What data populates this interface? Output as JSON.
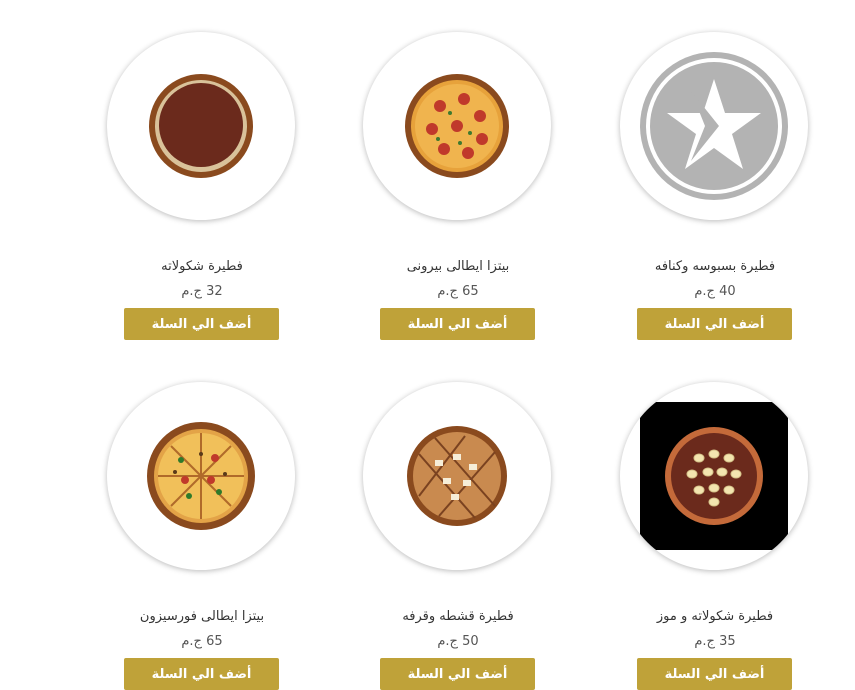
{
  "currency_label": "ج.م",
  "products": [
    {
      "name": "فطيرة بسبوسه وكنافه",
      "price": "40 ج.م",
      "button": "أضف الي السلة",
      "image": "placeholder-logo-icon"
    },
    {
      "name": "بيتزا ايطالى بيرونى",
      "price": "65 ج.م",
      "button": "أضف الي السلة",
      "image": "pepperoni-pizza-image"
    },
    {
      "name": "فطيرة شكولاته",
      "price": "32 ج.م",
      "button": "أضف الي السلة",
      "image": "chocolate-pie-image"
    },
    {
      "name": "فطيرة شكولاته و موز",
      "price": "35 ج.م",
      "button": "أضف الي السلة",
      "image": "chocolate-banana-pie-image"
    },
    {
      "name": "فطيرة قشطه وقرفه",
      "price": "50 ج.م",
      "button": "أضف الي السلة",
      "image": "cream-cinnamon-pie-image"
    },
    {
      "name": "بيتزا ايطالى فورسيزون",
      "price": "65 ج.م",
      "button": "أضف الي السلة",
      "image": "four-seasons-pizza-image"
    }
  ]
}
